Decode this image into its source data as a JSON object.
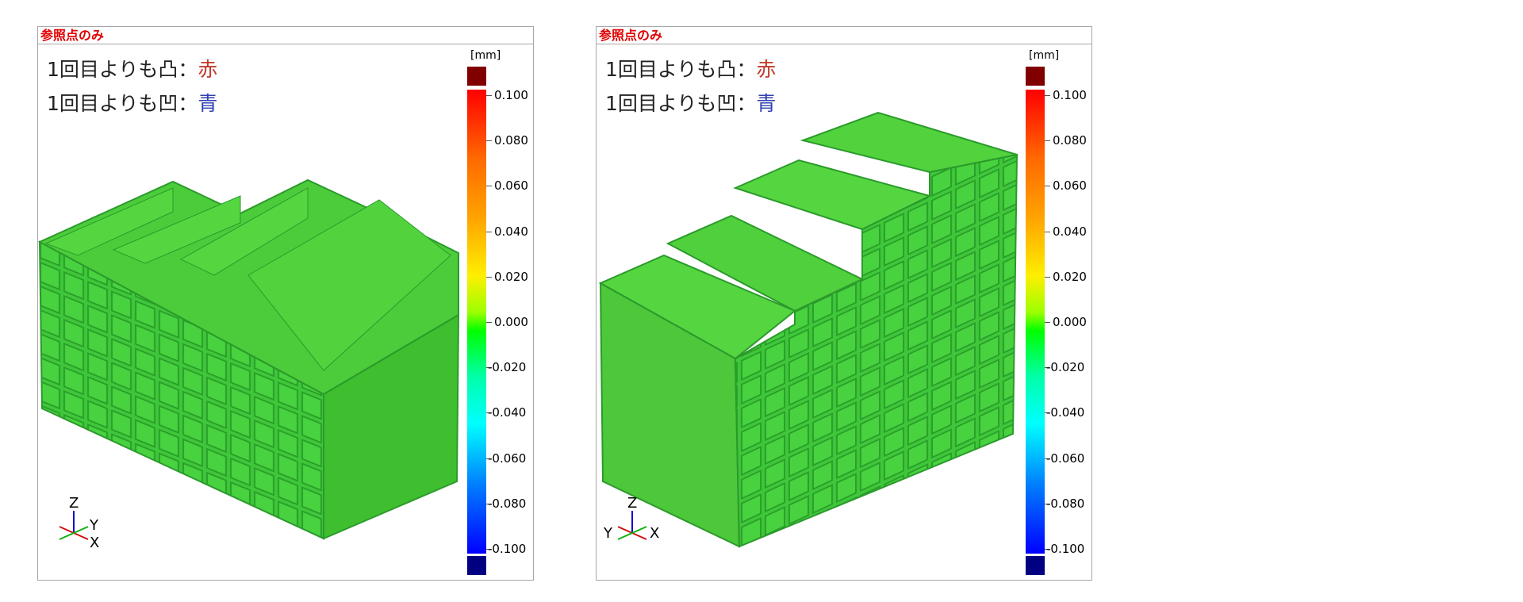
{
  "panels": [
    {
      "title": "参照点のみ",
      "line1": {
        "prefix": "1回目よりも凸：",
        "word": "赤"
      },
      "line2": {
        "prefix": "1回目よりも凹：",
        "word": "青"
      },
      "axes": {
        "z": "Z",
        "right": "Y",
        "bottom": "X"
      }
    },
    {
      "title": "参照点のみ",
      "line1": {
        "prefix": "1回目よりも凸：",
        "word": "赤"
      },
      "line2": {
        "prefix": "1回目よりも凹：",
        "word": "青"
      },
      "axes": {
        "z": "Z",
        "left": "Y",
        "right": "X"
      }
    }
  ],
  "colorbar": {
    "unit": "[mm]",
    "ticks": [
      "0.100",
      "0.080",
      "0.060",
      "0.040",
      "0.020",
      "0.000",
      "-0.020",
      "-0.040",
      "-0.060",
      "-0.080",
      "-0.100"
    ]
  },
  "colors": {
    "convex": "#c0392b",
    "concave": "#3040b0",
    "title": "#e00000"
  }
}
